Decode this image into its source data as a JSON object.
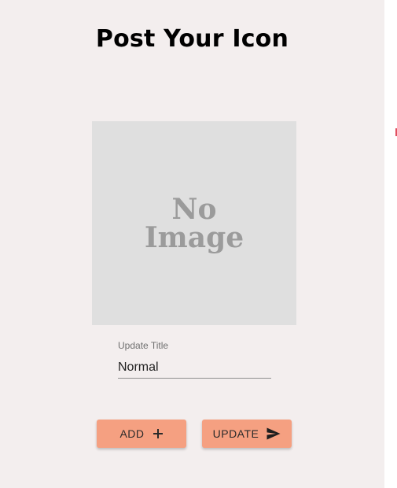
{
  "page": {
    "title": "Post Your Icon"
  },
  "image_placeholder": {
    "text": "No\nImage"
  },
  "update_title": {
    "label": "Update Title",
    "value": "Normal"
  },
  "buttons": {
    "add_label": "ADD",
    "add_icon": "plus-icon",
    "update_label": "UPDATE",
    "update_icon": "send-icon"
  },
  "colors": {
    "panel_background": "#f3eeee",
    "button_background": "#f5a081",
    "placeholder_background": "#dfdfdf"
  }
}
